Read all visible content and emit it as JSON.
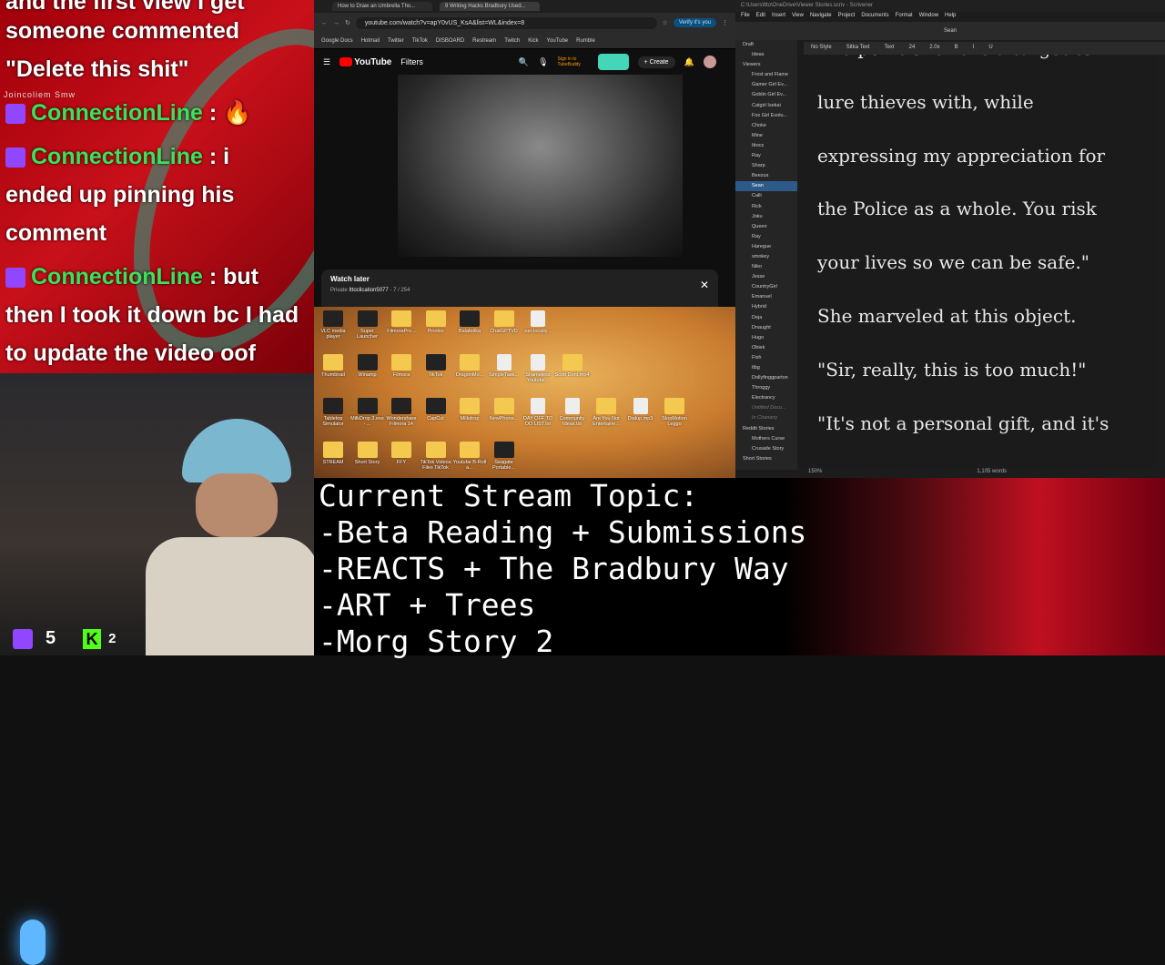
{
  "chat": {
    "lines": [
      "and the first view I get",
      "someone commented",
      "\"Delete this shit\""
    ],
    "joined": "Joincoliem Smw",
    "messages": [
      {
        "user": "ConnectionLine",
        "text": " : 🔥"
      },
      {
        "user": "ConnectionLine",
        "text": " : i"
      },
      {
        "text": "ended up pinning his"
      },
      {
        "text": "comment"
      },
      {
        "user": "ConnectionLine",
        "text": " : but"
      },
      {
        "text": "then I took it down bc I had"
      },
      {
        "text": "to update the video oof"
      }
    ]
  },
  "counts": {
    "twitch": "5",
    "kick": "2",
    "kick_letter": "K"
  },
  "browser": {
    "tabs": [
      "How to Draw an Umbrella Tho...",
      "9 Writing Hacks Bradbury Used..."
    ],
    "url": "youtube.com/watch?v=apY0vUS_KsA&list=WL&index=8",
    "verify": "Verify it's you",
    "bookmarks": [
      "Google Docs",
      "Hotmail",
      "Twitter",
      "TikTok",
      "DISBOARD",
      "Restream",
      "Twitch",
      "Kick",
      "YouTube",
      "Rumble"
    ],
    "yt": {
      "logo": "YouTube",
      "filters": "Filters",
      "signin": "Sign in to TubeBuddy",
      "create": "+ Create"
    },
    "watch_later": {
      "title": "Watch later",
      "private": "Private",
      "owner": "Ittoclication5077",
      "position": "- 7 / 254",
      "close": "✕"
    }
  },
  "desktop": {
    "icons": [
      "VLC media player",
      "Super Launcher",
      "FilmoraPro...",
      "Pinokio",
      "Balabolka",
      "ChatGPTVD",
      "run-locally...",
      "Thumbnail",
      "Winamp",
      "Filmora",
      "TikTok",
      "DragonMo...",
      "SimpleTask...",
      "Shameless Youtube...",
      "Scott Dont.mp4",
      "Tabletop Simulator",
      "MilkDrop 3.exe - ...",
      "Wondershare Filmora 14",
      "CapCut",
      "Milkdrop",
      "NewPhone...",
      "DAY OFF TO DO LIST.txt",
      "Community Ideas.txt",
      "Are You Not Entertaine...",
      "Dialup.mp3",
      "StopMotion Leggo",
      "STREAM",
      "Short Story",
      "FFY",
      "TikTok Videos Files TikTok",
      "Youtube B-Roll a...",
      "Seagate Portable..."
    ]
  },
  "scrivener": {
    "title": "C:\\Users\\ltto\\OneDrive\\Viewer Stories.scriv - Scrivener",
    "menu": [
      "File",
      "Edit",
      "Insert",
      "View",
      "Navigate",
      "Project",
      "Documents",
      "Format",
      "Window",
      "Help"
    ],
    "doc_title": "Sean",
    "format": {
      "style": "No Style",
      "font": "Sitka Text",
      "type": "Text",
      "size": "24",
      "spacing": "2.0x"
    },
    "binder": [
      "Draft",
      "Ideas",
      "Viewers",
      "Frost and Flame",
      "Gamer Girl Ev...",
      "Goblin Girl Ev...",
      "Catgirl Isekai",
      "Fox Girl Evolu...",
      "Choke",
      "Mine",
      "Ittocs",
      "Ray",
      "Sharp",
      "Beezus",
      "Sean",
      "Calli",
      "Rick",
      "Joku",
      "Queen",
      "Ray",
      "Haregue",
      "smokey",
      "Niko",
      "Jesse",
      "CountryGirl",
      "Emanuel",
      "Hybrid",
      "Deja",
      "Dnaught",
      "Hugo",
      "Obiek",
      "Fish",
      "tlbg",
      "Dollyfinggparton",
      "Throggy",
      "Electrancy",
      "Untitled Docu...",
      "In Chanany",
      "Reddit Stories",
      "Mothers Curse",
      "Crusade Story",
      "Short Stories"
    ],
    "editor": [
      "The point of this is a target to",
      "lure thieves with, while",
      "expressing my appreciation for",
      "the Police as a whole. You risk",
      "your lives so we can be safe.\"",
      "She marveled at this object.",
      "\"Sir, really, this is too much!\"",
      "\"It's not a personal gift, and it's"
    ],
    "zoom": "150%",
    "words": "1,105 words"
  },
  "topic": [
    "Current Stream Topic:",
    "-Beta Reading + Submissions",
    "-REACTS + The Bradbury Way",
    "-ART + Trees",
    "-Morg Story 2"
  ]
}
